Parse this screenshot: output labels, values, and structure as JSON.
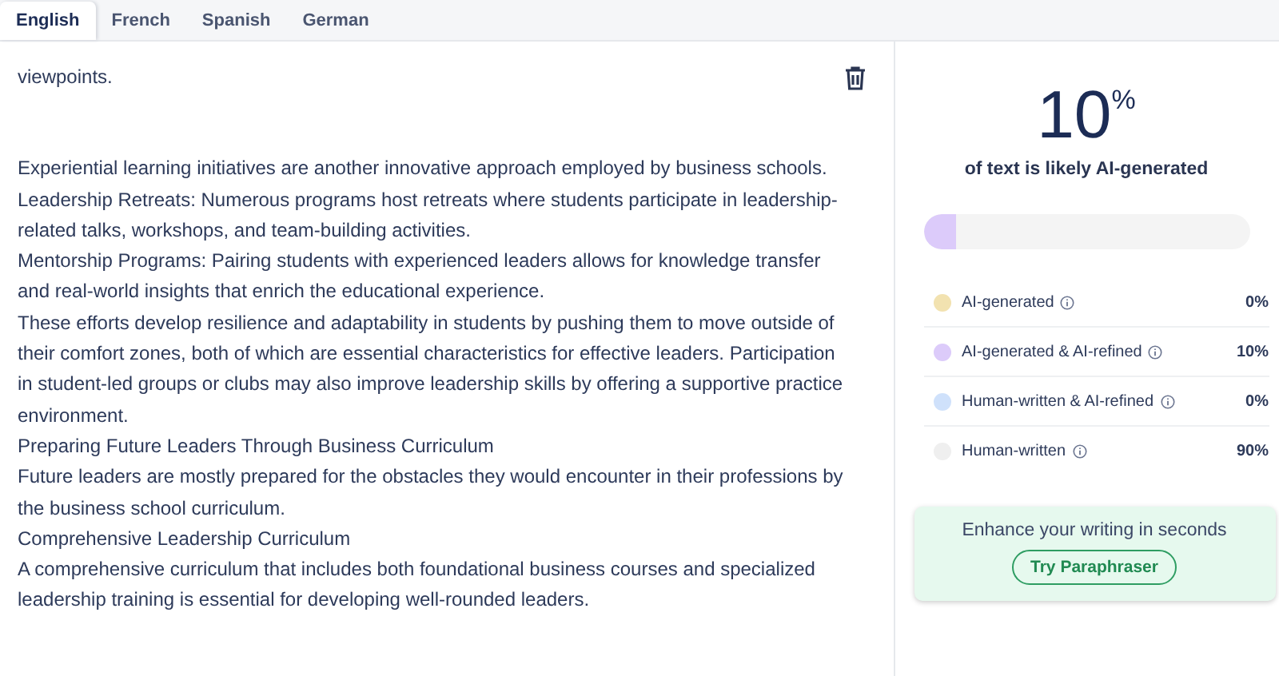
{
  "tabs": [
    {
      "label": "English",
      "selected": true
    },
    {
      "label": "French",
      "selected": false
    },
    {
      "label": "Spanish",
      "selected": false
    },
    {
      "label": "German",
      "selected": false
    }
  ],
  "editor": {
    "blocks": [
      [
        "viewpoints."
      ],
      [
        "Experiential learning initiatives are another innovative approach employed by business schools.",
        "Leadership Retreats: Numerous programs host retreats where students participate in leadership-related talks, workshops, and team-building activities.",
        "Mentorship Programs: Pairing students with experienced leaders allows for knowledge transfer and real-world insights that enrich the educational experience.",
        "These efforts develop resilience and adaptability in students by pushing them to move outside of their comfort zones, both of which are essential characteristics for effective leaders. Participation in student-led groups or clubs may also improve leadership skills by offering a supportive practice environment.",
        "Preparing Future Leaders Through Business Curriculum",
        "Future leaders are mostly prepared for the obstacles they would encounter in their professions by the business school curriculum.",
        "Comprehensive Leadership Curriculum",
        "A comprehensive curriculum that includes both foundational business courses and specialized leadership training is essential for developing well-rounded leaders."
      ]
    ]
  },
  "result": {
    "percent": "10",
    "percent_sign": "%",
    "caption": "of text is likely AI-generated",
    "level": 0.1,
    "categories": [
      {
        "label": "AI-generated",
        "value": "0%",
        "color": "#f2e2b0"
      },
      {
        "label": "AI-generated & AI-refined",
        "value": "10%",
        "color": "#dccbfa"
      },
      {
        "label": "Human-written & AI-refined",
        "value": "0%",
        "color": "#cfe1fb"
      },
      {
        "label": "Human-written",
        "value": "90%",
        "color": "#efefef"
      }
    ],
    "promo": {
      "text": "Enhance your writing in seconds",
      "button": "Try Paraphraser"
    }
  }
}
